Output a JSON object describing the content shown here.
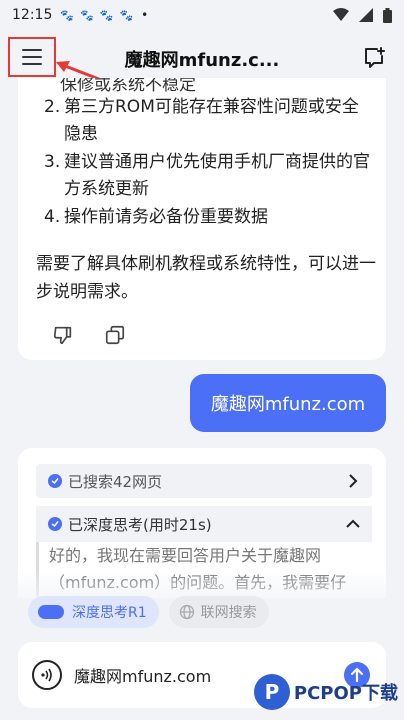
{
  "status": {
    "time": "12:15",
    "dot": "•"
  },
  "header": {
    "title": "魔趣网mfunz.c..."
  },
  "answer_top": {
    "partial_line": "保修或系统不稳定",
    "items": [
      {
        "num": "2.",
        "text": "第三方ROM可能存在兼容性问题或安全隐患"
      },
      {
        "num": "3.",
        "text": "建议普通用户优先使用手机厂商提供的官方系统更新"
      },
      {
        "num": "4.",
        "text": "操作前请务必备份重要数据"
      }
    ],
    "paragraph": "需要了解具体刷机教程或系统特性，可以进一步说明需求。"
  },
  "user_message": "魔趣网mfunz.com",
  "answer_new": {
    "searched": "已搜索42网页",
    "thinking": "已深度思考(用时21s)",
    "thinking_body": "好的，我现在需要回答用户关于魔趣网（mfunz.com）的问题。首先，我需要仔"
  },
  "chips": {
    "deep_think": "深度思考R1",
    "web_search": "联网搜索"
  },
  "input": {
    "text": "魔趣网mfunz.com"
  },
  "watermark": {
    "logo_letter": "P",
    "text": "PCPOP下载"
  },
  "colors": {
    "accent": "#4b6ff5",
    "highlight_box": "#e53935"
  }
}
